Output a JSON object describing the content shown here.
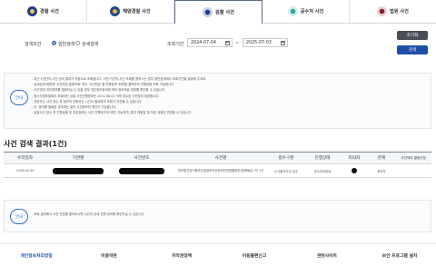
{
  "tabs": [
    {
      "label": "경찰 사건",
      "icon": "police-emblem-icon",
      "active": false
    },
    {
      "label": "해양경찰 사건",
      "icon": "coast-guard-emblem-icon",
      "active": false
    },
    {
      "label": "검찰 사건",
      "icon": "prosecution-emblem-icon",
      "active": true
    },
    {
      "label": "공수처 사건",
      "icon": "cio-emblem-icon",
      "active": false
    },
    {
      "label": "법원 사건",
      "icon": "court-emblem-icon",
      "active": false
    }
  ],
  "search": {
    "condition_label": "검색조건",
    "option_simple": "일반검색",
    "option_detail": "상세검색",
    "period_label": "조회기간",
    "date_from": "2024-07-04",
    "date_to": "2025-07-03",
    "range_sep": "~",
    "reset_label": "초기화",
    "search_label": "검색"
  },
  "notice": {
    "guide_label": "안내",
    "lines": [
      "- 최근 1년간의 사건 검색 결과가 자동으로 조회됩니다. 이전 기간의 사건 조회를 원하시는 경우 일반검색에서 조회기간을 설정해 주세요.",
      "- 상세검색 화면에 '사건번호 통합조회' 또는 '사건번호 별 진행정보' 화면을 클릭하여 진행현황 조회 가능합니다.",
      "- 사건관련 개인정보를 열람하실 수 있을 경우 개인정보동의에 따라 정보제공 범위를 확인할 수 있습니다.",
      "- 형사사법포털에서 조회되는 검찰 사건진행정보는 2011.06.01 이후 접수된 사건부터 제공합니다.",
      "- 관련자는 사건 접수 후 정보의 연동되는 시간이 필요하여 조회가 지연될 수 있습니다.",
      "- 단, 동의를 철회한 경우에는 일반 사건정보만 확인이 가능합니다.",
      "- 검찰사건 접수 후 진행상황 및 처분결과는 사건 진행에 따라 확인 가능하며, 통지 예정일 및 처분 내용은 변경될 수 있습니다."
    ]
  },
  "results": {
    "title": "사건 검색 결과(1건)",
    "columns": [
      "수리일자",
      "기관명",
      "사건번호",
      "사건명",
      "접수구분",
      "진행상태",
      "피의자",
      "관계",
      "사건처리 열람신청"
    ],
    "rows": [
      {
        "date": "2026-04-30",
        "agency": "",
        "case_no": "",
        "case_name": "정보통신망이용촉진및정보보호등에관한법률위반(명예훼손) 외 1건",
        "reception": "수사통지사건 접수",
        "status": "접수처리완료",
        "suspect": "",
        "relation": "피의자",
        "apply": ""
      }
    ]
  },
  "notice2": {
    "guide_label": "안내",
    "text": "- 조회 결과에서 사건 번호를 클릭하시면 사건의 상세 진행 정보를 확인하실 수 있습니다."
  },
  "footer": {
    "items": [
      "개인정보처리방침",
      "이용약관",
      "저작권정책",
      "이용불편신고",
      "관련사이트",
      "보안 프로그램 설치"
    ]
  },
  "colors": {
    "primary": "#1e4ea8",
    "reset_button": "#4a4f57",
    "search_button": "#1e4ea8"
  }
}
